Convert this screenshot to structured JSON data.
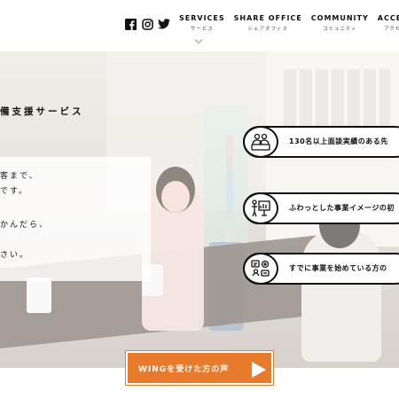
{
  "header": {
    "social": [
      {
        "icon": "facebook-icon"
      },
      {
        "icon": "instagram-icon"
      },
      {
        "icon": "twitter-icon"
      }
    ],
    "nav": [
      {
        "en": "SERVICES",
        "ja": "サービス"
      },
      {
        "en": "SHARE OFFICE",
        "ja": "シェアオフィス"
      },
      {
        "en": "COMMUNITY",
        "ja": "コミュニティ"
      },
      {
        "en": "ACCESS",
        "ja": "アクセス"
      }
    ]
  },
  "hero": {
    "section_title": "備支援サービス",
    "text_lines": [
      "客まで、",
      "です。",
      "かんだら、",
      "さい。"
    ],
    "features": [
      {
        "icon": "consultation-icon",
        "label": "130名以上面談実績のある先"
      },
      {
        "icon": "idea-board-icon",
        "label": "ふわっとした事業イメージの初"
      },
      {
        "icon": "business-tools-icon",
        "label": "すでに事業を始めている方の"
      }
    ]
  },
  "cta": {
    "label": "WINGを受けた方の声",
    "accent": "#e87b2b"
  }
}
